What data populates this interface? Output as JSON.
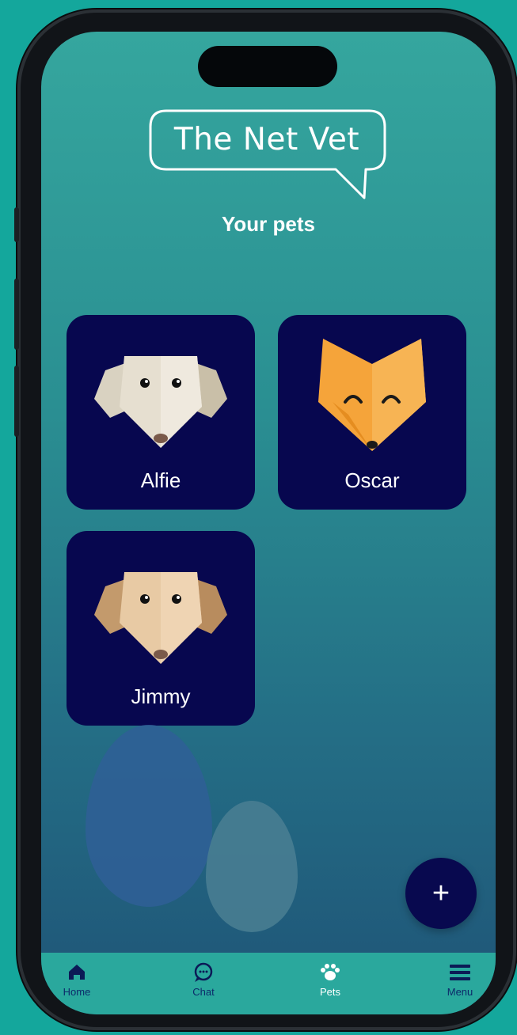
{
  "app": {
    "logo_text": "The Net Vet",
    "subtitle": "Your pets"
  },
  "pets": [
    {
      "name": "Alfie",
      "icon": "cream-dog-icon"
    },
    {
      "name": "Oscar",
      "icon": "fox-icon"
    },
    {
      "name": "Jimmy",
      "icon": "tan-dog-icon"
    }
  ],
  "fab": {
    "label": "+",
    "icon": "plus-icon"
  },
  "tabbar": {
    "items": [
      {
        "label": "Home",
        "icon": "home-icon"
      },
      {
        "label": "Chat",
        "icon": "chat-icon"
      },
      {
        "label": "Pets",
        "icon": "paw-icon"
      },
      {
        "label": "Menu",
        "icon": "menu-icon"
      }
    ]
  },
  "colors": {
    "background": "#14a79c",
    "card": "#07074f",
    "tabbar": "#2aa89d",
    "fab": "#08094f"
  }
}
